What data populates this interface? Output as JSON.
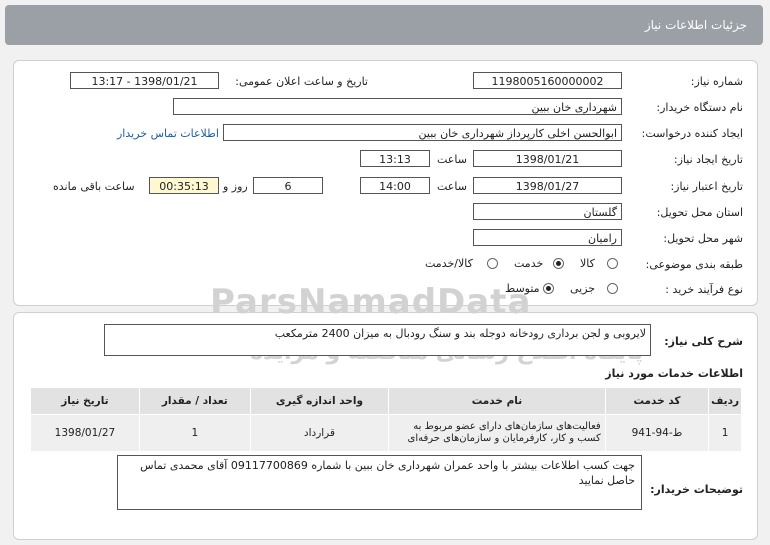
{
  "window": {
    "title": "جزئیات اطلاعات نیاز"
  },
  "form": {
    "need_number": {
      "label": "شماره نیاز:",
      "value": "1198005160000002"
    },
    "announce": {
      "label": "تاریخ و ساعت اعلان عمومی:",
      "value": "1398/01/21 - 13:17"
    },
    "buyer_org": {
      "label": "نام دستگاه خریدار:",
      "value": "شهرداری خان ببین"
    },
    "requester": {
      "label": "ایجاد کننده درخواست:",
      "value": "ابوالحسن اخلی کارپرداز شهرداری خان ببین",
      "contact_link": "اطلاعات تماس خریدار"
    },
    "created": {
      "label": "تاریخ ایجاد نیاز:",
      "date": "1398/01/21",
      "time_label": "ساعت",
      "time": "13:13"
    },
    "validity": {
      "label": "تاریخ اعتبار نیاز:",
      "date": "1398/01/27",
      "time_label": "ساعت",
      "time": "14:00",
      "days": "6",
      "days_label": "روز و",
      "remaining": "00:35:13",
      "remaining_label": "ساعت باقی مانده"
    },
    "province": {
      "label": "استان محل تحویل:",
      "value": "گلستان"
    },
    "city": {
      "label": "شهر محل تحویل:",
      "value": "رامیان"
    },
    "category": {
      "label": "طبقه بندی موضوعی:",
      "opt1": "کالا",
      "opt2": "خدمت",
      "opt3": "کالا/خدمت",
      "selected": "خدمت"
    },
    "process": {
      "label": "نوع فرآیند خرید :",
      "opt1": "جزیی",
      "opt2": "متوسط",
      "selected": "متوسط"
    }
  },
  "description": {
    "label": "شرح کلی نیاز:",
    "value": "لایروبی و لجن برداری رودخانه دوجله بند و سنگ رودبال به میزان 2400 مترمکعب"
  },
  "services": {
    "title": "اطلاعات خدمات مورد نیاز",
    "headers": [
      "ردیف",
      "کد خدمت",
      "نام خدمت",
      "واحد اندازه گیری",
      "تعداد / مقدار",
      "تاریخ نیاز"
    ],
    "rows": [
      [
        "1",
        "ط-94-941",
        "فعالیت‌های سازمان‌های دارای عضو مربوط به کسب و کار، کارفرمایان و سازمان‌های حرفه‌ای",
        "قرارداد",
        "1",
        "1398/01/27"
      ]
    ]
  },
  "buyer_notes": {
    "label": "توضیحات خریدار:",
    "value": "جهت کسب اطلاعات بیشتر با واحد عمران شهرداری خان ببین با شماره 09117700869 آقای محمدی تماس حاصل نمایید"
  },
  "watermark": {
    "brand": "ParsNamadData",
    "tagline": "پایگاه اطلاع رسانی مناقصه و مزایده"
  }
}
